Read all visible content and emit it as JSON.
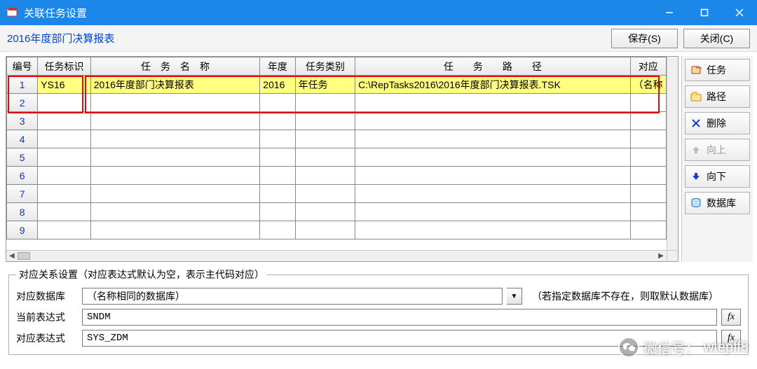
{
  "window": {
    "title": "关联任务设置"
  },
  "top": {
    "report_name": "2016年度部门决算报表",
    "save_label": "保存(S)",
    "close_label": "关闭(C)"
  },
  "grid": {
    "headers": {
      "num": "编号",
      "task_id": "任务标识",
      "task_name": "任　务　名　称",
      "year": "年度",
      "task_type": "任务类别",
      "task_path": "任　　务　　路　　径",
      "mapping": "对应"
    },
    "rows": [
      {
        "num": "1",
        "task_id": "YS16",
        "task_name": "2016年度部门决算报表",
        "year": "2016",
        "task_type": "年任务",
        "task_path": "C:\\RepTasks2016\\2016年度部门决算报表.TSK",
        "mapping": "（名称",
        "highlight": true
      },
      {
        "num": "2",
        "task_id": "",
        "task_name": "",
        "year": "",
        "task_type": "",
        "task_path": "",
        "mapping": ""
      },
      {
        "num": "3",
        "task_id": "",
        "task_name": "",
        "year": "",
        "task_type": "",
        "task_path": "",
        "mapping": ""
      },
      {
        "num": "4",
        "task_id": "",
        "task_name": "",
        "year": "",
        "task_type": "",
        "task_path": "",
        "mapping": ""
      },
      {
        "num": "5",
        "task_id": "",
        "task_name": "",
        "year": "",
        "task_type": "",
        "task_path": "",
        "mapping": ""
      },
      {
        "num": "6",
        "task_id": "",
        "task_name": "",
        "year": "",
        "task_type": "",
        "task_path": "",
        "mapping": ""
      },
      {
        "num": "7",
        "task_id": "",
        "task_name": "",
        "year": "",
        "task_type": "",
        "task_path": "",
        "mapping": ""
      },
      {
        "num": "8",
        "task_id": "",
        "task_name": "",
        "year": "",
        "task_type": "",
        "task_path": "",
        "mapping": ""
      },
      {
        "num": "9",
        "task_id": "",
        "task_name": "",
        "year": "",
        "task_type": "",
        "task_path": "",
        "mapping": ""
      }
    ]
  },
  "side": {
    "task": "任务",
    "path": "路径",
    "delete": "删除",
    "up": "向上",
    "down": "向下",
    "database": "数据库"
  },
  "relation": {
    "legend": "对应关系设置（对应表达式默认为空，表示主代码对应）",
    "db_label": "对应数据库",
    "db_value": "（名称相同的数据库）",
    "db_note": "（若指定数据库不存在，则取默认数据库）",
    "cur_label": "当前表达式",
    "cur_value": "SNDM",
    "map_label": "对应表达式",
    "map_value": "SYS_ZDM",
    "fx": "fx"
  },
  "watermark": {
    "prefix": "微信号：",
    "id": "wtepff8"
  }
}
